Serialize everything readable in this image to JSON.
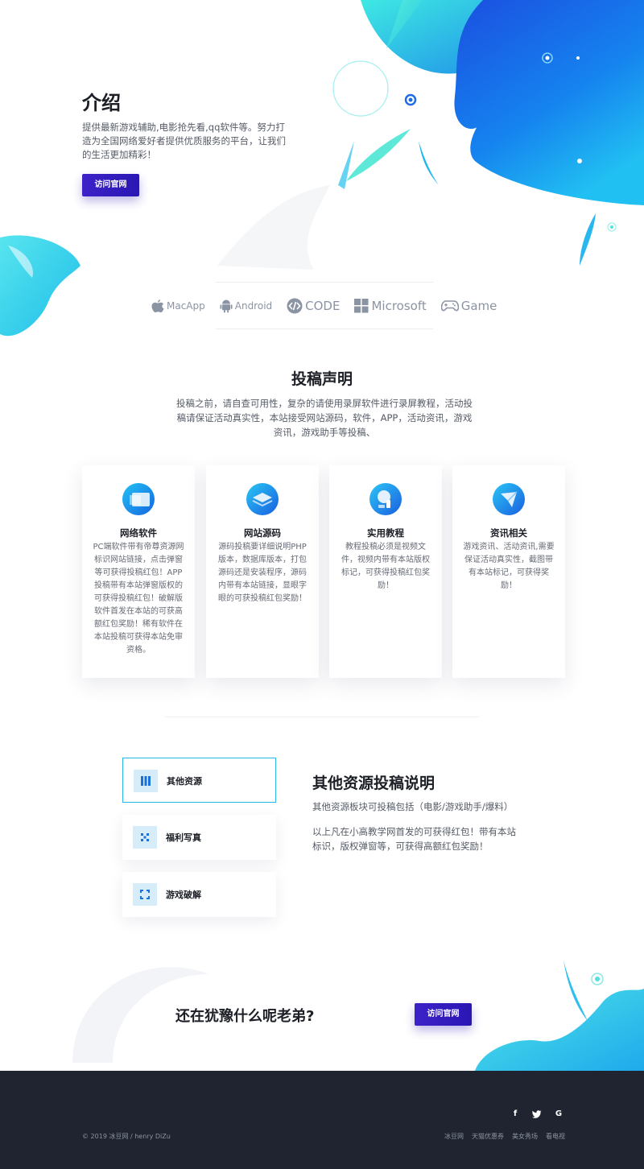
{
  "intro": {
    "title": "介绍",
    "description": "提供最新游戏辅助,电影抢先看,qq软件等。努力打造为全国网络爱好者提供优质服务的平台，让我们的生活更加精彩！",
    "button_label": "访问官网"
  },
  "platforms": [
    {
      "label": "MacApp",
      "icon": "apple-icon"
    },
    {
      "label": "Android",
      "icon": "android-icon"
    },
    {
      "label": "CODE",
      "icon": "code-icon"
    },
    {
      "label": "Microsoft",
      "icon": "windows-icon"
    },
    {
      "label": "Game",
      "icon": "gamepad-icon"
    }
  ],
  "submission": {
    "title": "投稿声明",
    "description": "投稿之前，请自查可用性，复杂的请使用录屏软件进行录屏教程，活动投稿请保证活动真实性，本站接受网站源码，软件，APP，活动资讯，游戏资讯，游戏助手等投稿、",
    "cards": [
      {
        "title": "网络软件",
        "text": "PC端软件带有帝尊资源网标识网站链接，点击弹窗等可获得投稿红包！APP投稿带有本站弹窗版权的可获得投稿红包！破解版软件首发在本站的可获高额红包奖励！稀有软件在本站投稿可获得本站免审资格。",
        "icon": "window-icon"
      },
      {
        "title": "网站源码",
        "text": "源码投稿要详细说明PHP版本，数据库版本，打包源码还是安装程序，源码内带有本站链接，显眼字眼的可获投稿红包奖励！",
        "icon": "layers-icon"
      },
      {
        "title": "实用教程",
        "text": "教程投稿必须是视频文件，视频内带有本站版权标记，可获得投稿红包奖励！",
        "icon": "tutorial-icon"
      },
      {
        "title": "资讯相关",
        "text": "游戏资讯、活动资讯,需要保证活动真实性，截图带有本站标记，可获得奖励！",
        "icon": "paper-plane-icon"
      }
    ]
  },
  "other": {
    "tabs": [
      {
        "label": "其他资源",
        "icon": "columns-icon"
      },
      {
        "label": "福利写真",
        "icon": "grid-icon"
      },
      {
        "label": "游戏破解",
        "icon": "frame-icon"
      }
    ],
    "title": "其他资源投稿说明",
    "p1": "其他资源板块可投稿包括（电影/游戏助手/爆料）",
    "p2": "以上凡在小高教学网首发的可获得红包！带有本站标识，版权弹窗等，可获得高额红包奖励！"
  },
  "cta": {
    "text": "还在犹豫什么呢老弟?",
    "button_label": "访问官网"
  },
  "footer": {
    "copyright": "© 2019 冰豆网 / henry DiZu",
    "social": [
      "f",
      "t",
      "G"
    ],
    "links": [
      "冰豆网",
      "天猫优惠券",
      "美女秀场",
      "看电视"
    ]
  },
  "colors": {
    "primary_button": "#2a17b3",
    "footer_bg": "#1f2430",
    "accent_blue": "#1e6fe8",
    "accent_cyan": "#3ee0e8"
  }
}
